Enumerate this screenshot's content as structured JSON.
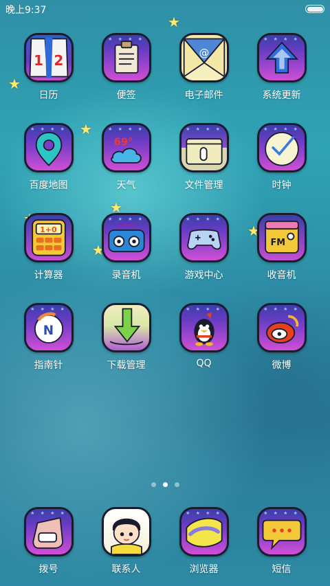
{
  "status": {
    "time": "晚上9:37"
  },
  "apps": [
    {
      "label": "日历",
      "icon": "calendar-icon"
    },
    {
      "label": "便签",
      "icon": "notes-icon"
    },
    {
      "label": "电子邮件",
      "icon": "email-icon"
    },
    {
      "label": "系统更新",
      "icon": "system-update-icon"
    },
    {
      "label": "百度地图",
      "icon": "map-icon"
    },
    {
      "label": "天气",
      "icon": "weather-icon"
    },
    {
      "label": "文件管理",
      "icon": "file-manager-icon"
    },
    {
      "label": "时钟",
      "icon": "clock-icon"
    },
    {
      "label": "计算器",
      "icon": "calculator-icon"
    },
    {
      "label": "录音机",
      "icon": "recorder-icon"
    },
    {
      "label": "游戏中心",
      "icon": "gamepad-icon"
    },
    {
      "label": "收音机",
      "icon": "radio-icon"
    },
    {
      "label": "指南针",
      "icon": "compass-icon"
    },
    {
      "label": "下载管理",
      "icon": "download-icon"
    },
    {
      "label": "QQ",
      "icon": "qq-penguin-icon"
    },
    {
      "label": "微博",
      "icon": "weibo-icon"
    }
  ],
  "dock": [
    {
      "label": "拨号",
      "icon": "phone-icon"
    },
    {
      "label": "联系人",
      "icon": "contacts-icon"
    },
    {
      "label": "浏览器",
      "icon": "browser-icon"
    },
    {
      "label": "短信",
      "icon": "messages-icon"
    }
  ],
  "pager": {
    "count": 3,
    "active": 1
  },
  "calendar_icon_text": {
    "left": "1",
    "right": "2"
  },
  "compass_icon_text": "N",
  "colors": {
    "accent_star": "#ffe86a",
    "icon_frame": "#1b1b2e"
  }
}
